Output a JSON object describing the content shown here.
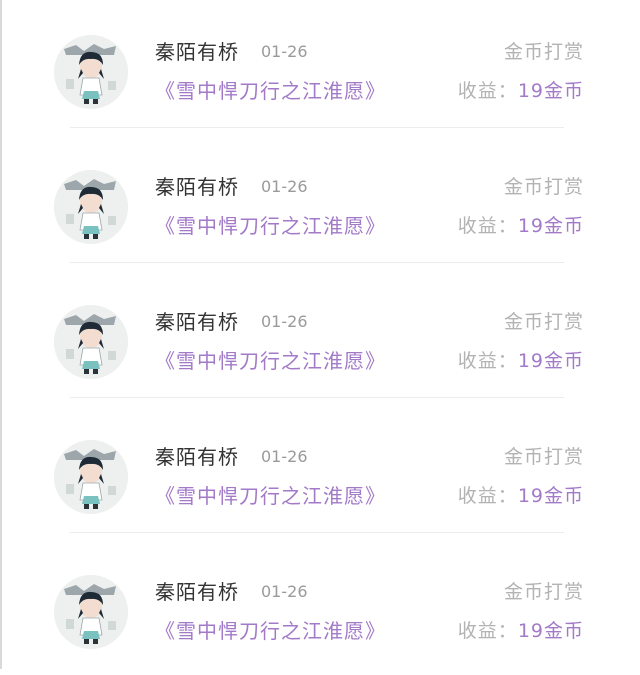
{
  "rewards": [
    {
      "avatar_icon": "chibi-character-avatar-icon",
      "name": "秦陌有桥",
      "date": "01-26",
      "book_title": "《雪中悍刀行之江淮愿》",
      "reward_type": "金币打赏",
      "income_label": "收益：",
      "income_value": "19金币"
    },
    {
      "avatar_icon": "chibi-character-avatar-icon",
      "name": "秦陌有桥",
      "date": "01-26",
      "book_title": "《雪中悍刀行之江淮愿》",
      "reward_type": "金币打赏",
      "income_label": "收益：",
      "income_value": "19金币"
    },
    {
      "avatar_icon": "chibi-character-avatar-icon",
      "name": "秦陌有桥",
      "date": "01-26",
      "book_title": "《雪中悍刀行之江淮愿》",
      "reward_type": "金币打赏",
      "income_label": "收益：",
      "income_value": "19金币"
    },
    {
      "avatar_icon": "chibi-character-avatar-icon",
      "name": "秦陌有桥",
      "date": "01-26",
      "book_title": "《雪中悍刀行之江淮愿》",
      "reward_type": "金币打赏",
      "income_label": "收益：",
      "income_value": "19金币"
    },
    {
      "avatar_icon": "chibi-character-avatar-icon",
      "name": "秦陌有桥",
      "date": "01-26",
      "book_title": "《雪中悍刀行之江淮愿》",
      "reward_type": "金币打赏",
      "income_label": "收益：",
      "income_value": "19金币"
    }
  ],
  "colors": {
    "accent_purple": "#a27ac8",
    "muted_gray": "#b3b3b3",
    "name_text": "#333333",
    "divider": "#ececec"
  }
}
